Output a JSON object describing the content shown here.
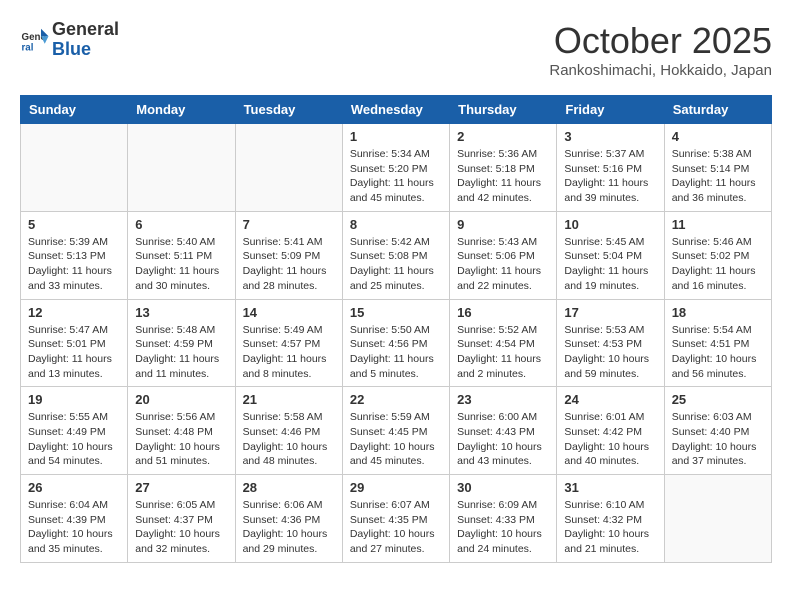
{
  "header": {
    "logo_line1": "General",
    "logo_line2": "Blue",
    "month": "October 2025",
    "location": "Rankoshimachi, Hokkaido, Japan"
  },
  "days_of_week": [
    "Sunday",
    "Monday",
    "Tuesday",
    "Wednesday",
    "Thursday",
    "Friday",
    "Saturday"
  ],
  "weeks": [
    [
      {
        "day": "",
        "info": ""
      },
      {
        "day": "",
        "info": ""
      },
      {
        "day": "",
        "info": ""
      },
      {
        "day": "1",
        "info": "Sunrise: 5:34 AM\nSunset: 5:20 PM\nDaylight: 11 hours\nand 45 minutes."
      },
      {
        "day": "2",
        "info": "Sunrise: 5:36 AM\nSunset: 5:18 PM\nDaylight: 11 hours\nand 42 minutes."
      },
      {
        "day": "3",
        "info": "Sunrise: 5:37 AM\nSunset: 5:16 PM\nDaylight: 11 hours\nand 39 minutes."
      },
      {
        "day": "4",
        "info": "Sunrise: 5:38 AM\nSunset: 5:14 PM\nDaylight: 11 hours\nand 36 minutes."
      }
    ],
    [
      {
        "day": "5",
        "info": "Sunrise: 5:39 AM\nSunset: 5:13 PM\nDaylight: 11 hours\nand 33 minutes."
      },
      {
        "day": "6",
        "info": "Sunrise: 5:40 AM\nSunset: 5:11 PM\nDaylight: 11 hours\nand 30 minutes."
      },
      {
        "day": "7",
        "info": "Sunrise: 5:41 AM\nSunset: 5:09 PM\nDaylight: 11 hours\nand 28 minutes."
      },
      {
        "day": "8",
        "info": "Sunrise: 5:42 AM\nSunset: 5:08 PM\nDaylight: 11 hours\nand 25 minutes."
      },
      {
        "day": "9",
        "info": "Sunrise: 5:43 AM\nSunset: 5:06 PM\nDaylight: 11 hours\nand 22 minutes."
      },
      {
        "day": "10",
        "info": "Sunrise: 5:45 AM\nSunset: 5:04 PM\nDaylight: 11 hours\nand 19 minutes."
      },
      {
        "day": "11",
        "info": "Sunrise: 5:46 AM\nSunset: 5:02 PM\nDaylight: 11 hours\nand 16 minutes."
      }
    ],
    [
      {
        "day": "12",
        "info": "Sunrise: 5:47 AM\nSunset: 5:01 PM\nDaylight: 11 hours\nand 13 minutes."
      },
      {
        "day": "13",
        "info": "Sunrise: 5:48 AM\nSunset: 4:59 PM\nDaylight: 11 hours\nand 11 minutes."
      },
      {
        "day": "14",
        "info": "Sunrise: 5:49 AM\nSunset: 4:57 PM\nDaylight: 11 hours\nand 8 minutes."
      },
      {
        "day": "15",
        "info": "Sunrise: 5:50 AM\nSunset: 4:56 PM\nDaylight: 11 hours\nand 5 minutes."
      },
      {
        "day": "16",
        "info": "Sunrise: 5:52 AM\nSunset: 4:54 PM\nDaylight: 11 hours\nand 2 minutes."
      },
      {
        "day": "17",
        "info": "Sunrise: 5:53 AM\nSunset: 4:53 PM\nDaylight: 10 hours\nand 59 minutes."
      },
      {
        "day": "18",
        "info": "Sunrise: 5:54 AM\nSunset: 4:51 PM\nDaylight: 10 hours\nand 56 minutes."
      }
    ],
    [
      {
        "day": "19",
        "info": "Sunrise: 5:55 AM\nSunset: 4:49 PM\nDaylight: 10 hours\nand 54 minutes."
      },
      {
        "day": "20",
        "info": "Sunrise: 5:56 AM\nSunset: 4:48 PM\nDaylight: 10 hours\nand 51 minutes."
      },
      {
        "day": "21",
        "info": "Sunrise: 5:58 AM\nSunset: 4:46 PM\nDaylight: 10 hours\nand 48 minutes."
      },
      {
        "day": "22",
        "info": "Sunrise: 5:59 AM\nSunset: 4:45 PM\nDaylight: 10 hours\nand 45 minutes."
      },
      {
        "day": "23",
        "info": "Sunrise: 6:00 AM\nSunset: 4:43 PM\nDaylight: 10 hours\nand 43 minutes."
      },
      {
        "day": "24",
        "info": "Sunrise: 6:01 AM\nSunset: 4:42 PM\nDaylight: 10 hours\nand 40 minutes."
      },
      {
        "day": "25",
        "info": "Sunrise: 6:03 AM\nSunset: 4:40 PM\nDaylight: 10 hours\nand 37 minutes."
      }
    ],
    [
      {
        "day": "26",
        "info": "Sunrise: 6:04 AM\nSunset: 4:39 PM\nDaylight: 10 hours\nand 35 minutes."
      },
      {
        "day": "27",
        "info": "Sunrise: 6:05 AM\nSunset: 4:37 PM\nDaylight: 10 hours\nand 32 minutes."
      },
      {
        "day": "28",
        "info": "Sunrise: 6:06 AM\nSunset: 4:36 PM\nDaylight: 10 hours\nand 29 minutes."
      },
      {
        "day": "29",
        "info": "Sunrise: 6:07 AM\nSunset: 4:35 PM\nDaylight: 10 hours\nand 27 minutes."
      },
      {
        "day": "30",
        "info": "Sunrise: 6:09 AM\nSunset: 4:33 PM\nDaylight: 10 hours\nand 24 minutes."
      },
      {
        "day": "31",
        "info": "Sunrise: 6:10 AM\nSunset: 4:32 PM\nDaylight: 10 hours\nand 21 minutes."
      },
      {
        "day": "",
        "info": ""
      }
    ]
  ]
}
